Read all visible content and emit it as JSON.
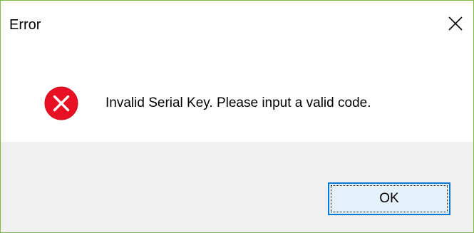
{
  "window": {
    "title": "Error",
    "close_icon": "close-icon"
  },
  "message": {
    "icon": "error-icon",
    "text": "Invalid Serial Key. Please input a valid code."
  },
  "buttons": {
    "ok_label": "OK"
  },
  "colors": {
    "window_border": "#7fba45",
    "error_icon_fill": "#e81123",
    "footer_background": "#f0f0f0",
    "button_border": "#0078d7",
    "button_background": "#e5f1fb"
  }
}
